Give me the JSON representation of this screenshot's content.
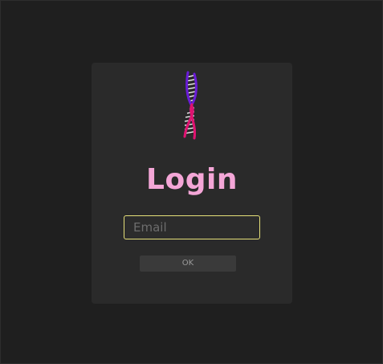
{
  "login": {
    "title": "Login",
    "email_placeholder": "Email",
    "email_value": "",
    "ok_label": "OK"
  },
  "logo": {
    "icon": "dna-helix-icon",
    "colors": [
      "#6a1bd8",
      "#e0136c",
      "#ffffff"
    ]
  },
  "theme": {
    "background": "#1f1f1f",
    "card": "#2a2a2a",
    "title_color": "#f4a6d7",
    "focus_border": "#e6e079",
    "button_bg": "#3a3a3a"
  }
}
